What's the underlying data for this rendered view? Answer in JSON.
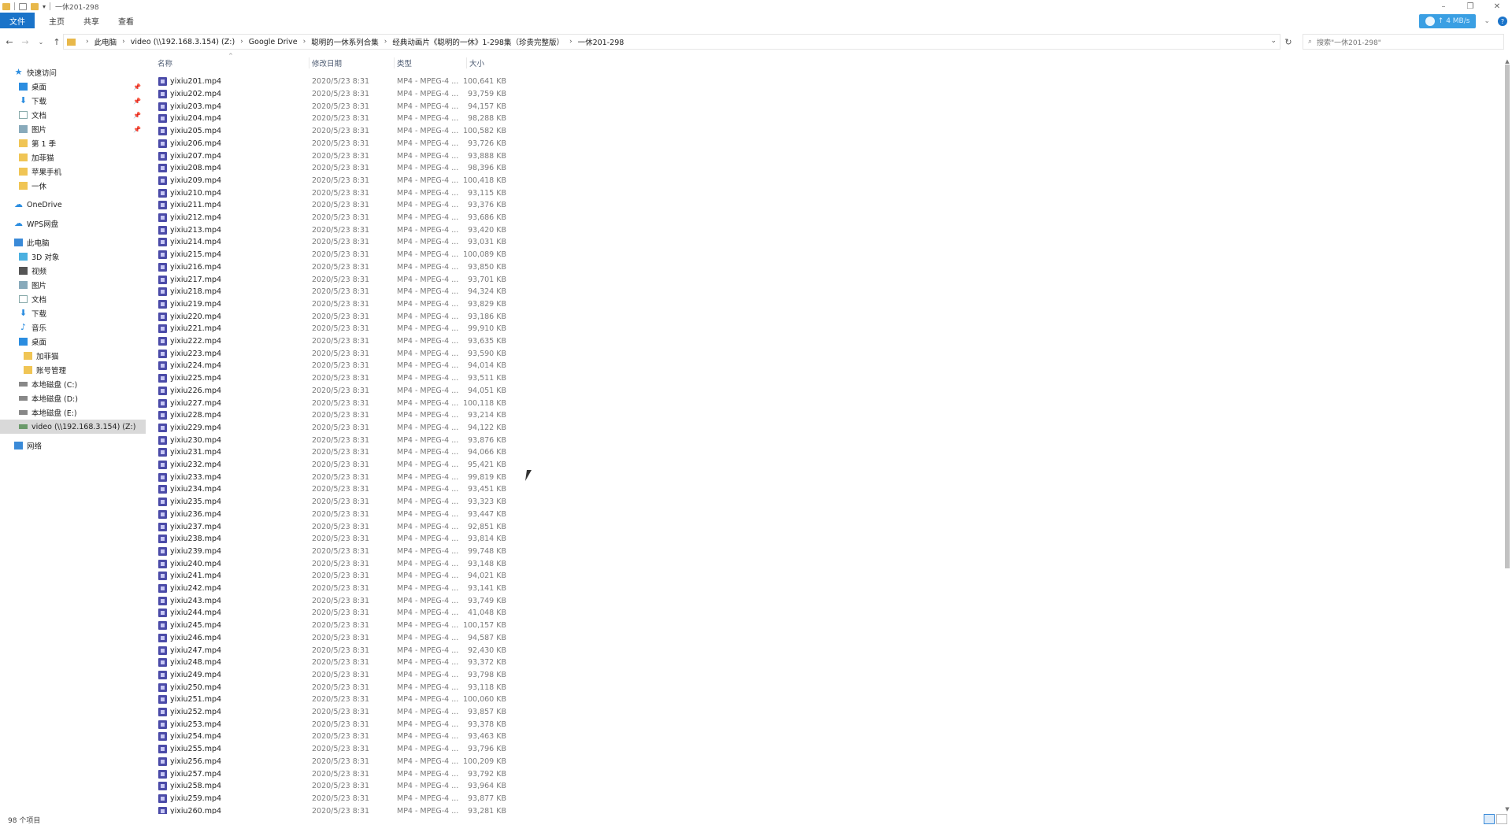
{
  "window": {
    "title": "一休201-298",
    "controls": [
      "–",
      "❐",
      "✕"
    ]
  },
  "ribbon": {
    "tabs": [
      "文件",
      "主页",
      "共享",
      "查看"
    ],
    "speed_badge": "↑ 4 MB/s"
  },
  "address": {
    "crumbs": [
      "此电脑",
      "video (\\\\192.168.3.154) (Z:)",
      "Google Drive",
      "聪明的一休系列合集",
      "经典动画片《聪明的一休》1-298集（珍贵完整版）",
      "一休201-298"
    ],
    "search_placeholder": "搜索\"一休201-298\""
  },
  "nav": {
    "quick_access": "快速访问",
    "quick_items": [
      {
        "label": "桌面",
        "icon": "desktop-icon",
        "pinned": true
      },
      {
        "label": "下载",
        "icon": "download-icon",
        "pinned": true
      },
      {
        "label": "文档",
        "icon": "document-icon",
        "pinned": true
      },
      {
        "label": "图片",
        "icon": "picture-icon",
        "pinned": true
      },
      {
        "label": "第 1 季",
        "icon": "folder-icon",
        "pinned": false
      },
      {
        "label": "加菲猫",
        "icon": "folder-icon",
        "pinned": false
      },
      {
        "label": "苹果手机",
        "icon": "folder-icon",
        "pinned": false
      },
      {
        "label": "一休",
        "icon": "folder-icon",
        "pinned": false
      }
    ],
    "onedrive": "OneDrive",
    "wps": "WPS网盘",
    "this_pc": "此电脑",
    "pc_items": [
      {
        "label": "3D 对象",
        "icon": "cube-icon"
      },
      {
        "label": "视频",
        "icon": "video-icon"
      },
      {
        "label": "图片",
        "icon": "picture-icon"
      },
      {
        "label": "文档",
        "icon": "document-icon"
      },
      {
        "label": "下载",
        "icon": "download-icon"
      },
      {
        "label": "音乐",
        "icon": "music-icon"
      },
      {
        "label": "桌面",
        "icon": "desktop-icon"
      }
    ],
    "desktop_children": [
      "加菲猫",
      "账号管理"
    ],
    "drives": [
      "本地磁盘 (C:)",
      "本地磁盘 (D:)",
      "本地磁盘 (E:)",
      "video (\\\\192.168.3.154) (Z:)"
    ],
    "network": "网络"
  },
  "columns": {
    "name": "名称",
    "date": "修改日期",
    "type": "类型",
    "size": "大小"
  },
  "files": [
    [
      "yixiu201.mp4",
      "2020/5/23 8:31",
      "MP4 - MPEG-4 ...",
      "100,641 KB"
    ],
    [
      "yixiu202.mp4",
      "2020/5/23 8:31",
      "MP4 - MPEG-4 ...",
      "93,759 KB"
    ],
    [
      "yixiu203.mp4",
      "2020/5/23 8:31",
      "MP4 - MPEG-4 ...",
      "94,157 KB"
    ],
    [
      "yixiu204.mp4",
      "2020/5/23 8:31",
      "MP4 - MPEG-4 ...",
      "98,288 KB"
    ],
    [
      "yixiu205.mp4",
      "2020/5/23 8:31",
      "MP4 - MPEG-4 ...",
      "100,582 KB"
    ],
    [
      "yixiu206.mp4",
      "2020/5/23 8:31",
      "MP4 - MPEG-4 ...",
      "93,726 KB"
    ],
    [
      "yixiu207.mp4",
      "2020/5/23 8:31",
      "MP4 - MPEG-4 ...",
      "93,888 KB"
    ],
    [
      "yixiu208.mp4",
      "2020/5/23 8:31",
      "MP4 - MPEG-4 ...",
      "98,396 KB"
    ],
    [
      "yixiu209.mp4",
      "2020/5/23 8:31",
      "MP4 - MPEG-4 ...",
      "100,418 KB"
    ],
    [
      "yixiu210.mp4",
      "2020/5/23 8:31",
      "MP4 - MPEG-4 ...",
      "93,115 KB"
    ],
    [
      "yixiu211.mp4",
      "2020/5/23 8:31",
      "MP4 - MPEG-4 ...",
      "93,376 KB"
    ],
    [
      "yixiu212.mp4",
      "2020/5/23 8:31",
      "MP4 - MPEG-4 ...",
      "93,686 KB"
    ],
    [
      "yixiu213.mp4",
      "2020/5/23 8:31",
      "MP4 - MPEG-4 ...",
      "93,420 KB"
    ],
    [
      "yixiu214.mp4",
      "2020/5/23 8:31",
      "MP4 - MPEG-4 ...",
      "93,031 KB"
    ],
    [
      "yixiu215.mp4",
      "2020/5/23 8:31",
      "MP4 - MPEG-4 ...",
      "100,089 KB"
    ],
    [
      "yixiu216.mp4",
      "2020/5/23 8:31",
      "MP4 - MPEG-4 ...",
      "93,850 KB"
    ],
    [
      "yixiu217.mp4",
      "2020/5/23 8:31",
      "MP4 - MPEG-4 ...",
      "93,701 KB"
    ],
    [
      "yixiu218.mp4",
      "2020/5/23 8:31",
      "MP4 - MPEG-4 ...",
      "94,324 KB"
    ],
    [
      "yixiu219.mp4",
      "2020/5/23 8:31",
      "MP4 - MPEG-4 ...",
      "93,829 KB"
    ],
    [
      "yixiu220.mp4",
      "2020/5/23 8:31",
      "MP4 - MPEG-4 ...",
      "93,186 KB"
    ],
    [
      "yixiu221.mp4",
      "2020/5/23 8:31",
      "MP4 - MPEG-4 ...",
      "99,910 KB"
    ],
    [
      "yixiu222.mp4",
      "2020/5/23 8:31",
      "MP4 - MPEG-4 ...",
      "93,635 KB"
    ],
    [
      "yixiu223.mp4",
      "2020/5/23 8:31",
      "MP4 - MPEG-4 ...",
      "93,590 KB"
    ],
    [
      "yixiu224.mp4",
      "2020/5/23 8:31",
      "MP4 - MPEG-4 ...",
      "94,014 KB"
    ],
    [
      "yixiu225.mp4",
      "2020/5/23 8:31",
      "MP4 - MPEG-4 ...",
      "93,511 KB"
    ],
    [
      "yixiu226.mp4",
      "2020/5/23 8:31",
      "MP4 - MPEG-4 ...",
      "94,051 KB"
    ],
    [
      "yixiu227.mp4",
      "2020/5/23 8:31",
      "MP4 - MPEG-4 ...",
      "100,118 KB"
    ],
    [
      "yixiu228.mp4",
      "2020/5/23 8:31",
      "MP4 - MPEG-4 ...",
      "93,214 KB"
    ],
    [
      "yixiu229.mp4",
      "2020/5/23 8:31",
      "MP4 - MPEG-4 ...",
      "94,122 KB"
    ],
    [
      "yixiu230.mp4",
      "2020/5/23 8:31",
      "MP4 - MPEG-4 ...",
      "93,876 KB"
    ],
    [
      "yixiu231.mp4",
      "2020/5/23 8:31",
      "MP4 - MPEG-4 ...",
      "94,066 KB"
    ],
    [
      "yixiu232.mp4",
      "2020/5/23 8:31",
      "MP4 - MPEG-4 ...",
      "95,421 KB"
    ],
    [
      "yixiu233.mp4",
      "2020/5/23 8:31",
      "MP4 - MPEG-4 ...",
      "99,819 KB"
    ],
    [
      "yixiu234.mp4",
      "2020/5/23 8:31",
      "MP4 - MPEG-4 ...",
      "93,451 KB"
    ],
    [
      "yixiu235.mp4",
      "2020/5/23 8:31",
      "MP4 - MPEG-4 ...",
      "93,323 KB"
    ],
    [
      "yixiu236.mp4",
      "2020/5/23 8:31",
      "MP4 - MPEG-4 ...",
      "93,447 KB"
    ],
    [
      "yixiu237.mp4",
      "2020/5/23 8:31",
      "MP4 - MPEG-4 ...",
      "92,851 KB"
    ],
    [
      "yixiu238.mp4",
      "2020/5/23 8:31",
      "MP4 - MPEG-4 ...",
      "93,814 KB"
    ],
    [
      "yixiu239.mp4",
      "2020/5/23 8:31",
      "MP4 - MPEG-4 ...",
      "99,748 KB"
    ],
    [
      "yixiu240.mp4",
      "2020/5/23 8:31",
      "MP4 - MPEG-4 ...",
      "93,148 KB"
    ],
    [
      "yixiu241.mp4",
      "2020/5/23 8:31",
      "MP4 - MPEG-4 ...",
      "94,021 KB"
    ],
    [
      "yixiu242.mp4",
      "2020/5/23 8:31",
      "MP4 - MPEG-4 ...",
      "93,141 KB"
    ],
    [
      "yixiu243.mp4",
      "2020/5/23 8:31",
      "MP4 - MPEG-4 ...",
      "93,749 KB"
    ],
    [
      "yixiu244.mp4",
      "2020/5/23 8:31",
      "MP4 - MPEG-4 ...",
      "41,048 KB"
    ],
    [
      "yixiu245.mp4",
      "2020/5/23 8:31",
      "MP4 - MPEG-4 ...",
      "100,157 KB"
    ],
    [
      "yixiu246.mp4",
      "2020/5/23 8:31",
      "MP4 - MPEG-4 ...",
      "94,587 KB"
    ],
    [
      "yixiu247.mp4",
      "2020/5/23 8:31",
      "MP4 - MPEG-4 ...",
      "92,430 KB"
    ],
    [
      "yixiu248.mp4",
      "2020/5/23 8:31",
      "MP4 - MPEG-4 ...",
      "93,372 KB"
    ],
    [
      "yixiu249.mp4",
      "2020/5/23 8:31",
      "MP4 - MPEG-4 ...",
      "93,798 KB"
    ],
    [
      "yixiu250.mp4",
      "2020/5/23 8:31",
      "MP4 - MPEG-4 ...",
      "93,118 KB"
    ],
    [
      "yixiu251.mp4",
      "2020/5/23 8:31",
      "MP4 - MPEG-4 ...",
      "100,060 KB"
    ],
    [
      "yixiu252.mp4",
      "2020/5/23 8:31",
      "MP4 - MPEG-4 ...",
      "93,857 KB"
    ],
    [
      "yixiu253.mp4",
      "2020/5/23 8:31",
      "MP4 - MPEG-4 ...",
      "93,378 KB"
    ],
    [
      "yixiu254.mp4",
      "2020/5/23 8:31",
      "MP4 - MPEG-4 ...",
      "93,463 KB"
    ],
    [
      "yixiu255.mp4",
      "2020/5/23 8:31",
      "MP4 - MPEG-4 ...",
      "93,796 KB"
    ],
    [
      "yixiu256.mp4",
      "2020/5/23 8:31",
      "MP4 - MPEG-4 ...",
      "100,209 KB"
    ],
    [
      "yixiu257.mp4",
      "2020/5/23 8:31",
      "MP4 - MPEG-4 ...",
      "93,792 KB"
    ],
    [
      "yixiu258.mp4",
      "2020/5/23 8:31",
      "MP4 - MPEG-4 ...",
      "93,964 KB"
    ],
    [
      "yixiu259.mp4",
      "2020/5/23 8:31",
      "MP4 - MPEG-4 ...",
      "93,877 KB"
    ],
    [
      "yixiu260.mp4",
      "2020/5/23 8:31",
      "MP4 - MPEG-4 ...",
      "93,281 KB"
    ]
  ],
  "status": {
    "item_count": "98 个项目"
  },
  "colors": {
    "accent": "#1a73c9",
    "selection": "#d9d9d9",
    "file_icon": "#4b4ba8"
  }
}
